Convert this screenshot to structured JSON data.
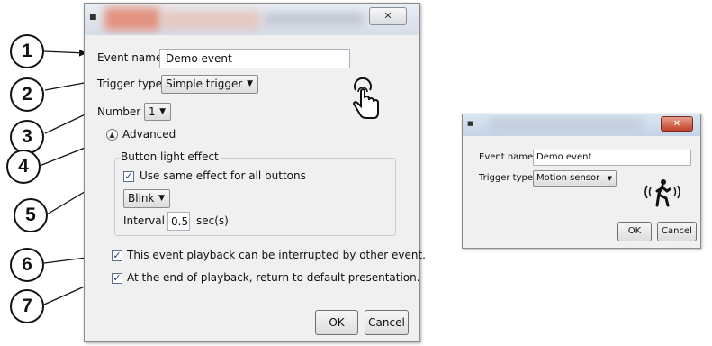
{
  "main_dialog": {
    "close_glyph": "✕",
    "event_name_label": "Event name",
    "event_name_value": "Demo event",
    "trigger_type_label": "Trigger type",
    "trigger_type_value": "Simple trigger",
    "number_label": "Number",
    "number_value": "1",
    "advanced_label": "Advanced",
    "button_light_effect_label": "Button light effect",
    "same_effect_label": "Use same effect for all buttons",
    "same_effect_checked": true,
    "effect_value": "Blink",
    "interval_label": "Interval",
    "interval_value": "0.5",
    "interval_unit": "sec(s)",
    "interrupt_label": "This event playback can be interrupted by other event.",
    "interrupt_checked": true,
    "return_label": "At the end of playback, return to default presentation.",
    "return_checked": true,
    "ok_label": "OK",
    "cancel_label": "Cancel",
    "icon": "hand-pointer-icon"
  },
  "callouts": [
    "1",
    "2",
    "3",
    "4",
    "5",
    "6",
    "7"
  ],
  "small_dialog": {
    "close_glyph": "✕",
    "event_name_label": "Event name",
    "event_name_value": "Demo event",
    "trigger_type_label": "Trigger type",
    "trigger_type_value": "Motion sensor",
    "ok_label": "OK",
    "cancel_label": "Cancel",
    "icon": "motion-sensor-icon"
  }
}
